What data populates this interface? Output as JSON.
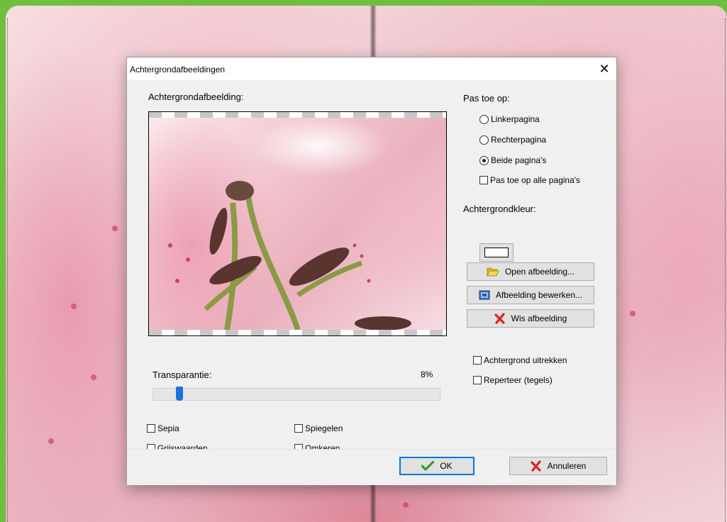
{
  "dialog": {
    "title": "Achtergrondafbeeldingen",
    "close_glyph": "✕"
  },
  "image_section": {
    "label": "Achtergrondafbeelding:"
  },
  "transparency": {
    "label": "Transparantie:",
    "value_text": "8%",
    "value_percent": 8
  },
  "effects": {
    "sepia": {
      "label": "Sepia",
      "checked": false
    },
    "grayscale": {
      "label": "Grijswaarden",
      "checked": false
    },
    "mirror": {
      "label": "Spiegelen",
      "checked": false
    },
    "invert": {
      "label": "Omkeren",
      "checked": false
    }
  },
  "apply_to": {
    "label": "Pas toe op:",
    "left_page": {
      "label": "Linkerpagina",
      "selected": false
    },
    "right_page": {
      "label": "Rechterpagina",
      "selected": false
    },
    "both_pages": {
      "label": "Beide pagina's",
      "selected": true
    },
    "all_pages": {
      "label": "Pas toe op alle pagina's",
      "checked": false
    }
  },
  "background_color": {
    "label": "Achtergrondkleur:",
    "color": "#ffffff"
  },
  "actions": {
    "open": {
      "label": "Open afbeelding...",
      "icon": "folder-open-icon"
    },
    "edit": {
      "label": "Afbeelding bewerken...",
      "icon": "image-edit-icon"
    },
    "clear": {
      "label": "Wis afbeelding",
      "icon": "red-x-icon"
    }
  },
  "layout_options": {
    "stretch": {
      "label": "Achtergrond uitrekken",
      "checked": false
    },
    "tile": {
      "label": "Reperteer (tegels)",
      "checked": false
    }
  },
  "footer": {
    "ok": {
      "label": "OK",
      "icon": "green-check-icon"
    },
    "cancel": {
      "label": "Annuleren",
      "icon": "red-x-icon"
    }
  },
  "colors": {
    "accent": "#0078d7",
    "window_frame": "#6fbf3f",
    "ok_green": "#2e9e2e",
    "cancel_red": "#d9261c"
  }
}
